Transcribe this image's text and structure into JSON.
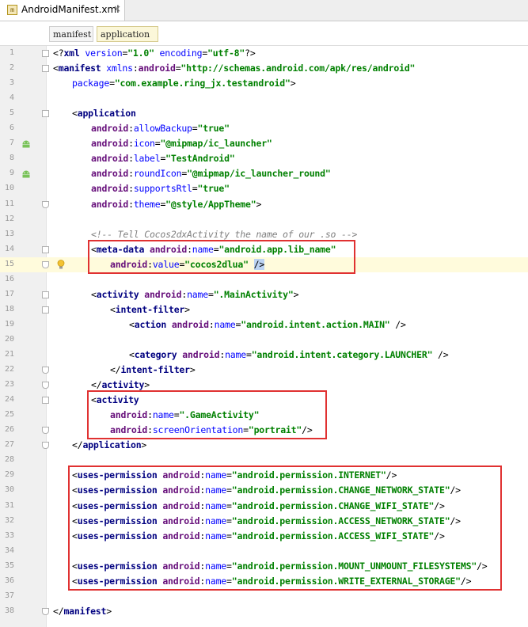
{
  "tab": {
    "label": "AndroidManifest.xml",
    "close": "×",
    "icon_letter": "m"
  },
  "breadcrumb": [
    {
      "label": "manifest"
    },
    {
      "label": "application"
    }
  ],
  "lines": [
    {
      "n": "1",
      "indent": 0,
      "segs": [
        [
          "p",
          "<?"
        ],
        [
          "t",
          "xml "
        ],
        [
          "a",
          "version"
        ],
        [
          "p",
          "="
        ],
        [
          "s",
          "\"1.0\""
        ],
        [
          "p",
          " "
        ],
        [
          "a",
          "encoding"
        ],
        [
          "p",
          "="
        ],
        [
          "s",
          "\"utf-8\""
        ],
        [
          "p",
          "?>"
        ]
      ]
    },
    {
      "n": "2",
      "indent": 0,
      "segs": [
        [
          "p",
          "<"
        ],
        [
          "t",
          "manifest "
        ],
        [
          "a",
          "xmlns"
        ],
        [
          "p",
          ":"
        ],
        [
          "ns",
          "android"
        ],
        [
          "p",
          "="
        ],
        [
          "s",
          "\"http://schemas.android.com/apk/res/android\""
        ]
      ]
    },
    {
      "n": "3",
      "indent": 2,
      "segs": [
        [
          "a",
          "package"
        ],
        [
          "p",
          "="
        ],
        [
          "s",
          "\"com.example.ring_jx.testandroid\""
        ],
        [
          "p",
          ">"
        ]
      ]
    },
    {
      "n": "4",
      "indent": 0,
      "segs": []
    },
    {
      "n": "5",
      "indent": 2,
      "segs": [
        [
          "p",
          "<"
        ],
        [
          "t",
          "application"
        ]
      ]
    },
    {
      "n": "6",
      "indent": 4,
      "segs": [
        [
          "ns",
          "android"
        ],
        [
          "p",
          ":"
        ],
        [
          "a",
          "allowBackup"
        ],
        [
          "p",
          "="
        ],
        [
          "s",
          "\"true\""
        ]
      ]
    },
    {
      "n": "7",
      "indent": 4,
      "segs": [
        [
          "ns",
          "android"
        ],
        [
          "p",
          ":"
        ],
        [
          "a",
          "icon"
        ],
        [
          "p",
          "="
        ],
        [
          "s",
          "\"@mipmap/ic_launcher\""
        ]
      ]
    },
    {
      "n": "8",
      "indent": 4,
      "segs": [
        [
          "ns",
          "android"
        ],
        [
          "p",
          ":"
        ],
        [
          "a",
          "label"
        ],
        [
          "p",
          "="
        ],
        [
          "s",
          "\"TestAndroid\""
        ]
      ]
    },
    {
      "n": "9",
      "indent": 4,
      "segs": [
        [
          "ns",
          "android"
        ],
        [
          "p",
          ":"
        ],
        [
          "a",
          "roundIcon"
        ],
        [
          "p",
          "="
        ],
        [
          "s",
          "\"@mipmap/ic_launcher_round\""
        ]
      ]
    },
    {
      "n": "10",
      "indent": 4,
      "segs": [
        [
          "ns",
          "android"
        ],
        [
          "p",
          ":"
        ],
        [
          "a",
          "supportsRtl"
        ],
        [
          "p",
          "="
        ],
        [
          "s",
          "\"true\""
        ]
      ]
    },
    {
      "n": "11",
      "indent": 4,
      "segs": [
        [
          "ns",
          "android"
        ],
        [
          "p",
          ":"
        ],
        [
          "a",
          "theme"
        ],
        [
          "p",
          "="
        ],
        [
          "s",
          "\"@style/AppTheme\""
        ],
        [
          "p",
          ">"
        ]
      ]
    },
    {
      "n": "12",
      "indent": 0,
      "segs": []
    },
    {
      "n": "13",
      "indent": 4,
      "segs": [
        [
          "c",
          "<!-- Tell Cocos2dxActivity the name of our .so -->"
        ]
      ]
    },
    {
      "n": "14",
      "indent": 4,
      "segs": [
        [
          "p",
          "<"
        ],
        [
          "t",
          "meta-data "
        ],
        [
          "ns",
          "android"
        ],
        [
          "p",
          ":"
        ],
        [
          "a",
          "name"
        ],
        [
          "p",
          "="
        ],
        [
          "s",
          "\"android.app.lib_name\""
        ]
      ]
    },
    {
      "n": "15",
      "indent": 6,
      "segs": [
        [
          "ns",
          "android"
        ],
        [
          "p",
          ":"
        ],
        [
          "a",
          "value"
        ],
        [
          "p",
          "="
        ],
        [
          "s",
          "\"cocos2dlua\""
        ],
        [
          "p",
          " "
        ],
        [
          "caret",
          "/>"
        ]
      ]
    },
    {
      "n": "16",
      "indent": 0,
      "segs": []
    },
    {
      "n": "17",
      "indent": 4,
      "segs": [
        [
          "p",
          "<"
        ],
        [
          "t",
          "activity "
        ],
        [
          "ns",
          "android"
        ],
        [
          "p",
          ":"
        ],
        [
          "a",
          "name"
        ],
        [
          "p",
          "="
        ],
        [
          "s",
          "\".MainActivity\""
        ],
        [
          "p",
          ">"
        ]
      ]
    },
    {
      "n": "18",
      "indent": 6,
      "segs": [
        [
          "p",
          "<"
        ],
        [
          "t",
          "intent-filter"
        ],
        [
          "p",
          ">"
        ]
      ]
    },
    {
      "n": "19",
      "indent": 8,
      "segs": [
        [
          "p",
          "<"
        ],
        [
          "t",
          "action "
        ],
        [
          "ns",
          "android"
        ],
        [
          "p",
          ":"
        ],
        [
          "a",
          "name"
        ],
        [
          "p",
          "="
        ],
        [
          "s",
          "\"android.intent.action.MAIN\""
        ],
        [
          "p",
          " />"
        ]
      ]
    },
    {
      "n": "20",
      "indent": 0,
      "segs": []
    },
    {
      "n": "21",
      "indent": 8,
      "segs": [
        [
          "p",
          "<"
        ],
        [
          "t",
          "category "
        ],
        [
          "ns",
          "android"
        ],
        [
          "p",
          ":"
        ],
        [
          "a",
          "name"
        ],
        [
          "p",
          "="
        ],
        [
          "s",
          "\"android.intent.category.LAUNCHER\""
        ],
        [
          "p",
          " />"
        ]
      ]
    },
    {
      "n": "22",
      "indent": 6,
      "segs": [
        [
          "p",
          "</"
        ],
        [
          "t",
          "intent-filter"
        ],
        [
          "p",
          ">"
        ]
      ]
    },
    {
      "n": "23",
      "indent": 4,
      "segs": [
        [
          "p",
          "</"
        ],
        [
          "t",
          "activity"
        ],
        [
          "p",
          ">"
        ]
      ]
    },
    {
      "n": "24",
      "indent": 4,
      "segs": [
        [
          "p",
          "<"
        ],
        [
          "t",
          "activity"
        ]
      ]
    },
    {
      "n": "25",
      "indent": 6,
      "segs": [
        [
          "ns",
          "android"
        ],
        [
          "p",
          ":"
        ],
        [
          "a",
          "name"
        ],
        [
          "p",
          "="
        ],
        [
          "s",
          "\".GameActivity\""
        ]
      ]
    },
    {
      "n": "26",
      "indent": 6,
      "segs": [
        [
          "ns",
          "android"
        ],
        [
          "p",
          ":"
        ],
        [
          "a",
          "screenOrientation"
        ],
        [
          "p",
          "="
        ],
        [
          "s",
          "\"portrait\""
        ],
        [
          "p",
          "/>"
        ]
      ]
    },
    {
      "n": "27",
      "indent": 2,
      "segs": [
        [
          "p",
          "</"
        ],
        [
          "t",
          "application"
        ],
        [
          "p",
          ">"
        ]
      ]
    },
    {
      "n": "28",
      "indent": 0,
      "segs": []
    },
    {
      "n": "29",
      "indent": 2,
      "segs": [
        [
          "p",
          "<"
        ],
        [
          "t",
          "uses-permission "
        ],
        [
          "ns",
          "android"
        ],
        [
          "p",
          ":"
        ],
        [
          "a",
          "name"
        ],
        [
          "p",
          "="
        ],
        [
          "s",
          "\"android.permission.INTERNET\""
        ],
        [
          "p",
          "/>"
        ]
      ]
    },
    {
      "n": "30",
      "indent": 2,
      "segs": [
        [
          "p",
          "<"
        ],
        [
          "t",
          "uses-permission "
        ],
        [
          "ns",
          "android"
        ],
        [
          "p",
          ":"
        ],
        [
          "a",
          "name"
        ],
        [
          "p",
          "="
        ],
        [
          "s",
          "\"android.permission.CHANGE_NETWORK_STATE\""
        ],
        [
          "p",
          "/>"
        ]
      ]
    },
    {
      "n": "31",
      "indent": 2,
      "segs": [
        [
          "p",
          "<"
        ],
        [
          "t",
          "uses-permission "
        ],
        [
          "ns",
          "android"
        ],
        [
          "p",
          ":"
        ],
        [
          "a",
          "name"
        ],
        [
          "p",
          "="
        ],
        [
          "s",
          "\"android.permission.CHANGE_WIFI_STATE\""
        ],
        [
          "p",
          "/>"
        ]
      ]
    },
    {
      "n": "32",
      "indent": 2,
      "segs": [
        [
          "p",
          "<"
        ],
        [
          "t",
          "uses-permission "
        ],
        [
          "ns",
          "android"
        ],
        [
          "p",
          ":"
        ],
        [
          "a",
          "name"
        ],
        [
          "p",
          "="
        ],
        [
          "s",
          "\"android.permission.ACCESS_NETWORK_STATE\""
        ],
        [
          "p",
          "/>"
        ]
      ]
    },
    {
      "n": "33",
      "indent": 2,
      "segs": [
        [
          "p",
          "<"
        ],
        [
          "t",
          "uses-permission "
        ],
        [
          "ns",
          "android"
        ],
        [
          "p",
          ":"
        ],
        [
          "a",
          "name"
        ],
        [
          "p",
          "="
        ],
        [
          "s",
          "\"android.permission.ACCESS_WIFI_STATE\""
        ],
        [
          "p",
          "/>"
        ]
      ]
    },
    {
      "n": "34",
      "indent": 0,
      "segs": []
    },
    {
      "n": "35",
      "indent": 2,
      "segs": [
        [
          "p",
          "<"
        ],
        [
          "t",
          "uses-permission "
        ],
        [
          "ns",
          "android"
        ],
        [
          "p",
          ":"
        ],
        [
          "a",
          "name"
        ],
        [
          "p",
          "="
        ],
        [
          "s",
          "\"android.permission.MOUNT_UNMOUNT_FILESYSTEMS\""
        ],
        [
          "p",
          "/>"
        ]
      ]
    },
    {
      "n": "36",
      "indent": 2,
      "segs": [
        [
          "p",
          "<"
        ],
        [
          "t",
          "uses-permission "
        ],
        [
          "ns",
          "android"
        ],
        [
          "p",
          ":"
        ],
        [
          "a",
          "name"
        ],
        [
          "p",
          "="
        ],
        [
          "s",
          "\"android.permission.WRITE_EXTERNAL_STORAGE\""
        ],
        [
          "p",
          "/>"
        ]
      ]
    },
    {
      "n": "37",
      "indent": 0,
      "segs": []
    },
    {
      "n": "38",
      "indent": 0,
      "segs": [
        [
          "p",
          "</"
        ],
        [
          "t",
          "manifest"
        ],
        [
          "p",
          ">"
        ]
      ]
    }
  ],
  "highlighted_line": "15",
  "gutter_icons": [
    {
      "line": "7",
      "icon": "android-icon"
    },
    {
      "line": "9",
      "icon": "android-icon"
    },
    {
      "line": "15",
      "icon": "lightbulb-icon"
    }
  ],
  "fold_markers": [
    {
      "line": "1",
      "kind": "start"
    },
    {
      "line": "2",
      "kind": "start"
    },
    {
      "line": "5",
      "kind": "start"
    },
    {
      "line": "11",
      "kind": "end"
    },
    {
      "line": "14",
      "kind": "start"
    },
    {
      "line": "15",
      "kind": "end"
    },
    {
      "line": "17",
      "kind": "start"
    },
    {
      "line": "18",
      "kind": "start"
    },
    {
      "line": "22",
      "kind": "end"
    },
    {
      "line": "23",
      "kind": "end"
    },
    {
      "line": "24",
      "kind": "start"
    },
    {
      "line": "26",
      "kind": "end"
    },
    {
      "line": "27",
      "kind": "end"
    },
    {
      "line": "38",
      "kind": "end"
    }
  ],
  "annotations": [
    {
      "label": "meta-data-box",
      "from_line": "14",
      "to_line": "15"
    },
    {
      "label": "game-activity-box",
      "from_line": "24",
      "to_line": "26"
    },
    {
      "label": "permissions-box",
      "from_line": "29",
      "to_line": "36"
    }
  ],
  "colors": {
    "annotation": "#e03131",
    "current_line": "#fffbdc"
  }
}
